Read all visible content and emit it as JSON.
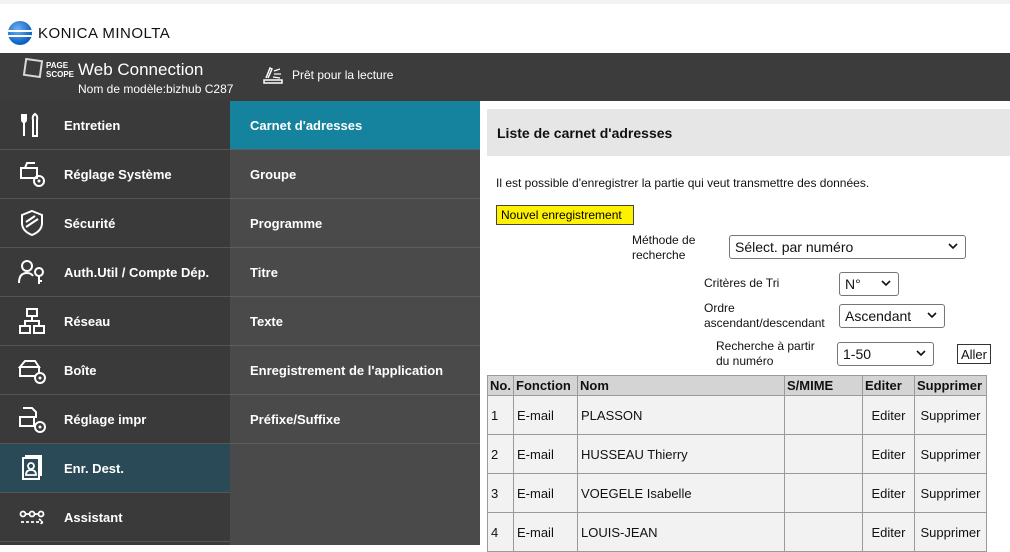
{
  "brand": {
    "name": "KONICA MINOLTA"
  },
  "header": {
    "logo_line1": "PAGE",
    "logo_line2": "SCOPE",
    "title": "Web Connection",
    "model": "Nom de modèle:bizhub C287",
    "status": "Prêt pour la lecture"
  },
  "nav1": {
    "items": [
      {
        "label": "Entretien",
        "icon": "wrench-icon"
      },
      {
        "label": "Réglage Système",
        "icon": "system-settings-icon"
      },
      {
        "label": "Sécurité",
        "icon": "shield-icon"
      },
      {
        "label": "Auth.Util / Compte Dép.",
        "icon": "user-key-icon"
      },
      {
        "label": "Réseau",
        "icon": "network-icon"
      },
      {
        "label": "Boîte",
        "icon": "box-icon"
      },
      {
        "label": "Réglage impr",
        "icon": "printer-settings-icon"
      },
      {
        "label": "Enr. Dest.",
        "icon": "address-book-icon",
        "active": true
      },
      {
        "label": "Assistant",
        "icon": "wizard-icon"
      }
    ]
  },
  "nav2": {
    "items": [
      {
        "label": "Carnet d'adresses",
        "active": true
      },
      {
        "label": "Groupe"
      },
      {
        "label": "Programme"
      },
      {
        "label": "Titre"
      },
      {
        "label": "Texte"
      },
      {
        "label": "Enregistrement de l'application"
      },
      {
        "label": "Préfixe/Suffixe"
      }
    ]
  },
  "content": {
    "title": "Liste de carnet d'adresses",
    "intro": "Il est possible d'enregistrer la partie qui veut transmettre des données.",
    "new_button": "Nouvel enregistrement",
    "search_method_label_1": "Méthode de",
    "search_method_label_2": "recherche",
    "search_method_value": "Sélect. par numéro",
    "sort_label": "Critères de Tri",
    "sort_value": "N°",
    "order_label_1": "Ordre",
    "order_label_2": "ascendant/descendant",
    "order_value": "Ascendant",
    "from_label_1": "Recherche à partir",
    "from_label_2": "du numéro",
    "from_value": "1-50",
    "go_button": "Aller",
    "columns": [
      "No.",
      "Fonction",
      "Nom",
      "S/MIME",
      "Editer",
      "Supprimer"
    ],
    "rows": [
      {
        "no": "1",
        "fonction": "E-mail",
        "nom": "PLASSON",
        "smime": "",
        "edit": "Editer",
        "delete": "Supprimer"
      },
      {
        "no": "2",
        "fonction": "E-mail",
        "nom": "HUSSEAU Thierry",
        "smime": "",
        "edit": "Editer",
        "delete": "Supprimer"
      },
      {
        "no": "3",
        "fonction": "E-mail",
        "nom": "VOEGELE Isabelle",
        "smime": "",
        "edit": "Editer",
        "delete": "Supprimer"
      },
      {
        "no": "4",
        "fonction": "E-mail",
        "nom": "LOUIS-JEAN",
        "smime": "",
        "edit": "Editer",
        "delete": "Supprimer"
      }
    ]
  },
  "colors": {
    "header_bg": "#3c3c3c",
    "nav_active": "#15829e",
    "highlight": "#fff200"
  }
}
